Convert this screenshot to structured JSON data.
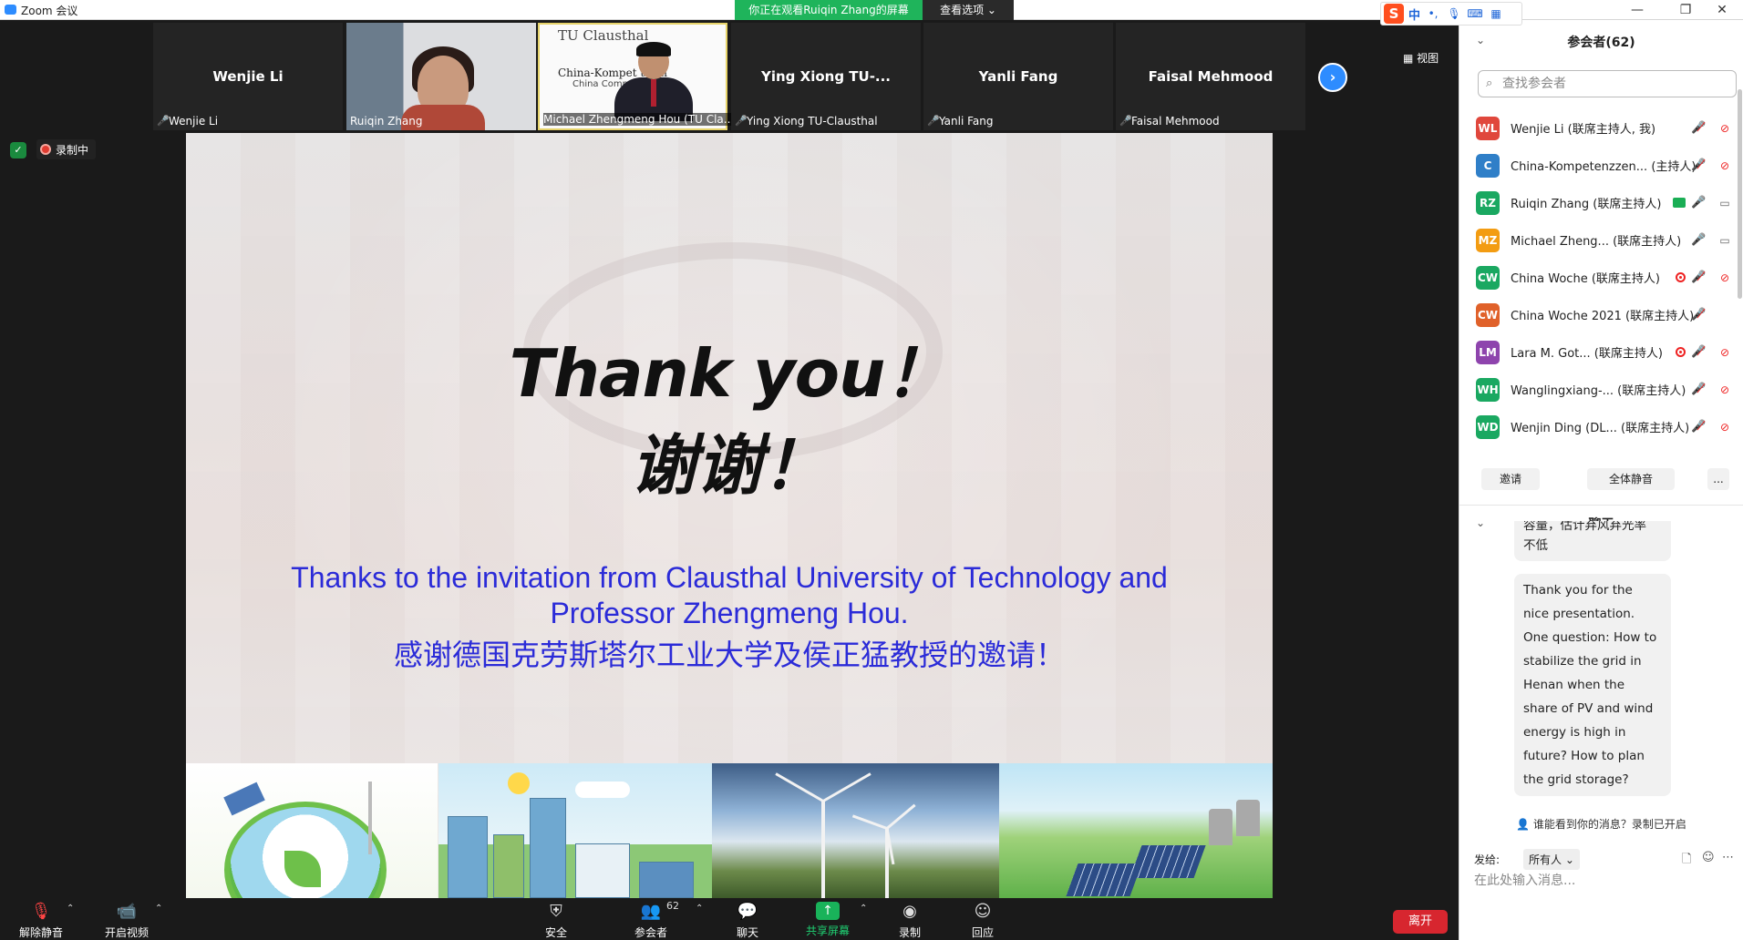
{
  "titlebar": {
    "title": "Zoom 会议",
    "viewing_banner": "你正在观看Ruiqin  Zhang的屏幕",
    "view_options": "查看选项 ⌄",
    "minimize": "—",
    "restore": "❐",
    "close": "✕"
  },
  "ime": {
    "logo": "S",
    "zh": "中",
    "punct": "•,",
    "mic": "🎙",
    "keyboard": "⌨",
    "grid": "▦"
  },
  "thumbs": [
    {
      "big": "Wenjie Li",
      "label": "Wenjie Li",
      "muted": true
    },
    {
      "big": "",
      "label": "Ruiqin Zhang",
      "muted": false
    },
    {
      "big": "",
      "label": "Michael Zhengmeng Hou (TU Cla...",
      "muted": false,
      "banner1": "TU Clausthal",
      "banner2": "China-Kompet        trum",
      "banner3": "China Compet        nter"
    },
    {
      "big": "Ying Xiong TU-...",
      "label": "Ying Xiong TU-Clausthal",
      "muted": true
    },
    {
      "big": "Yanli Fang",
      "label": "Yanli Fang",
      "muted": true
    },
    {
      "big": "Faisal Mehmood",
      "label": "Faisal Mehmood",
      "muted": true
    }
  ],
  "view_toggle": "▦ 视图",
  "recording_label": "录制中",
  "slide": {
    "thanks_en": "Thank you！",
    "thanks_zh": "谢谢！",
    "line1": "Thanks to the invitation from Clausthal University of Technology and",
    "line2": "Professor Zhengmeng Hou.",
    "line3": "感谢德国克劳斯塔尔工业大学及侯正猛教授的邀请！"
  },
  "toolbar": {
    "unmute": "解除静音",
    "start_video": "开启视频",
    "security": "安全",
    "participants": "参会者",
    "participants_count": "62",
    "chat": "聊天",
    "share": "共享屏幕",
    "record": "录制",
    "reactions": "回应",
    "leave": "离开"
  },
  "panel": {
    "participants_title": "参会者(62)",
    "search_placeholder": "查找参会者",
    "participants": [
      {
        "initials": "WL",
        "color": "#e0473c",
        "name": "Wenjie Li (联席主持人, 我)",
        "mic": "muted",
        "cam": "off",
        "extra": ""
      },
      {
        "initials": "C",
        "color": "#2f7fc8",
        "name": "China-Kompetenzzen... (主持人)",
        "mic": "muted",
        "cam": "off",
        "extra": ""
      },
      {
        "initials": "RZ",
        "color": "#1aa861",
        "name": "Ruiqin Zhang (联席主持人)",
        "mic": "on",
        "cam": "on",
        "extra": "share"
      },
      {
        "initials": "MZ",
        "color": "#f39c12",
        "name": "Michael Zheng...   (联席主持人)",
        "mic": "on",
        "cam": "on",
        "extra": ""
      },
      {
        "initials": "CW",
        "color": "#1aa861",
        "name": "China Woche (联席主持人)",
        "mic": "muted",
        "cam": "off",
        "extra": "rec"
      },
      {
        "initials": "CW",
        "color": "#e0612a",
        "name": "China Woche 2021 (联席主持人)",
        "mic": "muted",
        "cam": "",
        "extra": ""
      },
      {
        "initials": "LM",
        "color": "#8e44ad",
        "name": "Lara M. Got...  (联席主持人)",
        "mic": "muted",
        "cam": "off",
        "extra": "rec"
      },
      {
        "initials": "WH",
        "color": "#1aa861",
        "name": "Wanglingxiang-...  (联席主持人)",
        "mic": "muted",
        "cam": "off",
        "extra": ""
      },
      {
        "initials": "WD",
        "color": "#1aa861",
        "name": "Wenjin Ding (DL...   (联席主持人)",
        "mic": "muted",
        "cam": "off",
        "extra": ""
      }
    ],
    "invite": "邀请",
    "mute_all": "全体静音",
    "more": "...",
    "chat_title": "聊天",
    "chat_prev_line1": "容量，估计弃风弃光率",
    "chat_prev_line2": "不低",
    "chat_message": "Thank you for the nice presentation. One question: How to stabilize the grid in Henan when the share of PV and wind energy is high in future? How to plan the grid storage?",
    "visibility": "谁能看到你的消息？录制已开启",
    "to_label": "发给:",
    "to_value": "所有人 ⌄",
    "input_placeholder": "在此处输入消息..."
  }
}
